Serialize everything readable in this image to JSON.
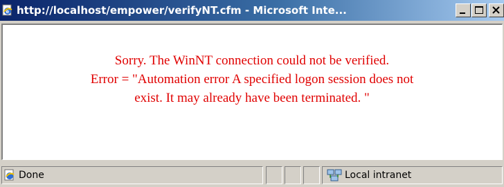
{
  "window": {
    "title": "http://localhost/empower/verifyNT.cfm - Microsoft Inte...",
    "title_icon": "ie-page-icon",
    "buttons": [
      "minimize",
      "maximize",
      "close"
    ]
  },
  "content": {
    "message_lines": [
      "Sorry. The WinNT connection could not be verified.",
      "Error = \"Automation error A specified logon session does not",
      "exist. It may already have been terminated. \""
    ],
    "text_color": "#e00000"
  },
  "statusbar": {
    "status_text": "Done",
    "zone_text": "Local intranet",
    "status_icon": "ie-page-done-icon",
    "zone_icon": "local-intranet-icon"
  }
}
